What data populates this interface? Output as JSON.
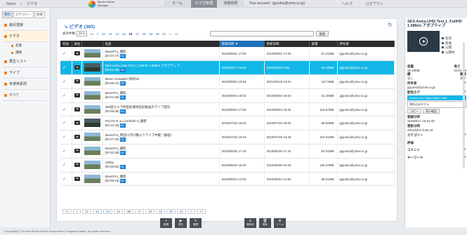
{
  "header": {
    "breadcrumb": [
      "Home",
      "/",
      "ビデオ"
    ],
    "brand_line1": "Media Gather",
    "brand_line2": "Manager",
    "tabs": [
      {
        "label": "ホーム",
        "active": false
      },
      {
        "label": "ビデオ管理",
        "active": true
      },
      {
        "label": "視聴制限",
        "active": false
      }
    ],
    "account": "Your account : [giyutsu@ymw.co.jp]",
    "help": "ヘルプ",
    "logout": "ログアウト"
  },
  "sidebar": {
    "tabs": [
      "種別",
      "カテゴリー",
      "詳細"
    ],
    "items": [
      {
        "label": "最近登録",
        "selected": false
      },
      {
        "label": "ビデオ",
        "selected": true
      },
      {
        "label": "再生リスト",
        "selected": false
      },
      {
        "label": "ライブ",
        "selected": false
      },
      {
        "label": "未使用素材",
        "selected": false
      },
      {
        "label": "すべて",
        "selected": false
      }
    ],
    "subitems": [
      "変換",
      "課題"
    ]
  },
  "main": {
    "title": "ビデオ (383)",
    "page_size_label": "表示件数",
    "page_size": "10",
    "pages": [
      "<<",
      "<",
      "12",
      "13",
      "14",
      "15",
      "16",
      "17",
      "18",
      "19",
      "20",
      "21",
      ">",
      ">>"
    ],
    "current_page": "16",
    "search_button": "検索",
    "columns": [
      "有効",
      "再生",
      "",
      "名前",
      "登録日時 ▼",
      "更新日時",
      "容量",
      "所有者"
    ],
    "rows": [
      {
        "name": "MavicPro_撮影",
        "dur": "[00:07:27]",
        "reg": "2018/09/01 17:00",
        "upd": "2018/09/01 17:00",
        "size": "51.21MB",
        "owner": "gijyutsu@ymw.co.jp",
        "hl": false,
        "dark": false
      },
      {
        "name": "SES.Astra.UHD.Test.1_FullHD 1.5Mb/s アダプティブ",
        "dur": "[00:01:49]",
        "reg": "2018/08/17 16:54",
        "upd": "2021/06/22 9:36",
        "size": "35.18MB",
        "owner": "gijyutsu@ymw.co.jp",
        "hl": true,
        "dark": true
      },
      {
        "name": "Mavic+Insta360+照射Ok",
        "dur": "[00:06:41]",
        "reg": "2018/08/04 23:53",
        "upd": "2021/05/19 13:21",
        "size": "247.5MB",
        "owner": "gijyutsu@ymw.co.jp",
        "hl": false,
        "dark": false
      },
      {
        "name": "MavicPro_撮影",
        "dur": "[00:01:58]",
        "reg": "2018/08/04 18:03",
        "upd": "2018/08/04 18:03",
        "size": "31.33MB",
        "owner": "gijyutsu@ymw.co.jp",
        "hl": false,
        "dark": false
      },
      {
        "name": "360度カメラ吹田産業術館前動画のライブ配信",
        "dur": "[00:08:05]",
        "reg": "2018/08/04 17:50",
        "upd": "2018/08/04 23:34",
        "size": "116.87MB",
        "owner": "gijyutsu@ymw.co.jp",
        "hl": false,
        "dark": false
      },
      {
        "name": "RICOH R or LiveShell X_撮影",
        "dur": "[00:13:46]",
        "reg": "2018/07/28 19:02",
        "upd": "2018/07/28 19:02",
        "size": "89.93MB",
        "owner": "gijyutsu@ymw.co.jp",
        "hl": false,
        "dark": true
      },
      {
        "name": "MavicPro_熊田川河川敷よりライブ中継（録画）",
        "dur": "[00:07:26]",
        "reg": "2018/07/15 19:19",
        "upd": "2018/07/28 14:45",
        "size": "118.01MB",
        "owner": "gijyutsu@ymw.co.jp",
        "hl": false,
        "dark": false
      },
      {
        "name": "MavicPro_撮影",
        "dur": "[00:03:38]",
        "reg": "2018/06/30 17:42",
        "upd": "2018/06/30 17:42",
        "size": "64.01MB",
        "owner": "gijyutsu@ymw.co.jp",
        "hl": false,
        "dark": false
      },
      {
        "name": "1080p",
        "dur": "[00:06:50]",
        "reg": "2018/06/30 16:40",
        "upd": "2018/06/30 16:40",
        "size": "126.24MB",
        "owner": "gijyutsu@ymw.co.jp",
        "hl": false,
        "dark": false
      },
      {
        "name": "MavicPro_撮影",
        "dur": "[00:09:23]",
        "reg": "2018/06/24 12:52",
        "upd": "2018/06/24 12:52",
        "size": "88.01MB",
        "owner": "gijyutsu@ymw.co.jp",
        "hl": false,
        "dark": false
      }
    ],
    "bottom_pages": [
      "<<",
      "<",
      "12",
      "13",
      "14",
      "15",
      "16",
      "17",
      "18",
      "19",
      "20",
      "21",
      ">",
      ">>"
    ]
  },
  "toolbar": {
    "left": [
      {
        "icon": "+",
        "label": "新規"
      },
      {
        "icon": "▶",
        "label": "再生"
      },
      {
        "icon": "✎",
        "label": "管理"
      }
    ],
    "right": [
      {
        "icon": "⦸",
        "label": "無効化"
      },
      {
        "icon": "🗑",
        "label": "削除"
      },
      {
        "icon": "⚙",
        "label": "ツール"
      }
    ]
  },
  "footer": "Copyright(C) Yondeln Media Works Incorporated, Kitagawa/Japan. All rights reserved.",
  "detail": {
    "title": "SES.Astra.UHD.Test.1_FullHD 1.5Mb/s アダプティブ",
    "status": [
      "有効",
      "変換",
      "公開",
      "公開中"
    ],
    "size_label": "容量",
    "size": "35.18MB",
    "dur_label": "長さ",
    "dur": "00:01:48",
    "lock_label": "鍵",
    "lock": "なし",
    "res_label": "解像",
    "res": "あり",
    "owner_label": "所有者",
    "owner": "gijyutsu@ymw.co.jp",
    "embed_label": "配信タグ",
    "embed": "<iframe src=\"https://api01.med",
    "select": "埋め込みタグ",
    "copy": "コピー",
    "preview": "表示確認",
    "reg_label": "登録日時",
    "reg": "2018/8/17 16:54:30",
    "upd_label": "更新日時",
    "upd": "2021/6/22 9:36:19",
    "cat_label": "カテゴリー",
    "rating_label": "評価",
    "comment_label": "コメント",
    "keyword_label": "キーワード"
  }
}
